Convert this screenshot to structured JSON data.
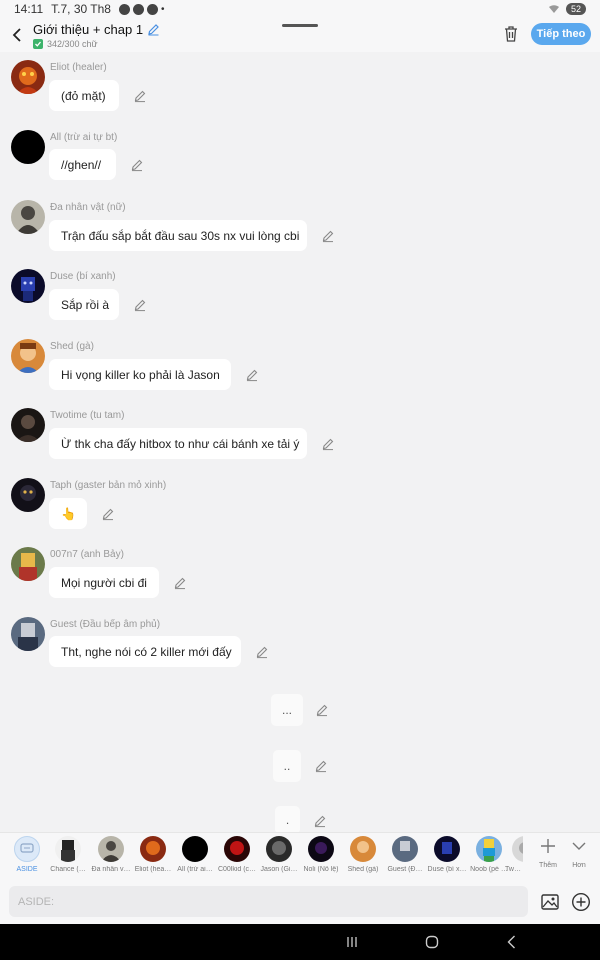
{
  "status": {
    "time": "14:11",
    "date": "T.7, 30 Th8",
    "battery": "52"
  },
  "header": {
    "title": "Giới thiệu + chap 1",
    "counter": "342/300 chữ",
    "next_label": "Tiếp theo"
  },
  "messages": [
    {
      "speaker": "Eliot (healer)",
      "text": "(đỏ mặt)"
    },
    {
      "speaker": "All (trừ ai tự bt)",
      "text": "//ghen//"
    },
    {
      "speaker": "Đa nhân vật (nữ)",
      "text": "Trận đấu sắp bắt đầu sau 30s nx vui lòng cbi"
    },
    {
      "speaker": "Duse (bí xanh)",
      "text": "Sắp rồi à"
    },
    {
      "speaker": "Shed (gà)",
      "text": "Hi vọng killer ko phải là Jason"
    },
    {
      "speaker": "Twotime (tu tam)",
      "text": "Ừ thk cha đấy hitbox to như cái bánh xe tải ý"
    },
    {
      "speaker": "Taph (gaster bản mỏ xinh)",
      "text": "👆"
    },
    {
      "speaker": "007n7 (anh Bảy)",
      "text": "Mọi người cbi đi"
    },
    {
      "speaker": "Guest (Đầu bếp âm phủ)",
      "text": "Tht, nghe nói có 2 killer mới đấy"
    }
  ],
  "asides": [
    "...",
    "..",
    "."
  ],
  "characters": [
    {
      "name": "ASIDE"
    },
    {
      "name": "Chance (…"
    },
    {
      "name": "Đa nhân v…"
    },
    {
      "name": "Eliot (hea…"
    },
    {
      "name": "All (trừ ai…"
    },
    {
      "name": "C00lkid (c…"
    },
    {
      "name": "Jason (Gi…"
    },
    {
      "name": "Noli (Nô lệ)"
    },
    {
      "name": "Shed (gà)"
    },
    {
      "name": "Guest (Đ…"
    },
    {
      "name": "Duse (bí x…"
    },
    {
      "name": "Noob (pé …"
    },
    {
      "name": "Tw…"
    }
  ],
  "tools": {
    "add_label": "Thêm",
    "more_label": "Hơn"
  },
  "input": {
    "placeholder": "ASIDE:"
  },
  "colors": {
    "accent": "#5aa8ee",
    "background": "#f2f2f3",
    "bubble": "#ffffff",
    "check": "#3db36b"
  }
}
